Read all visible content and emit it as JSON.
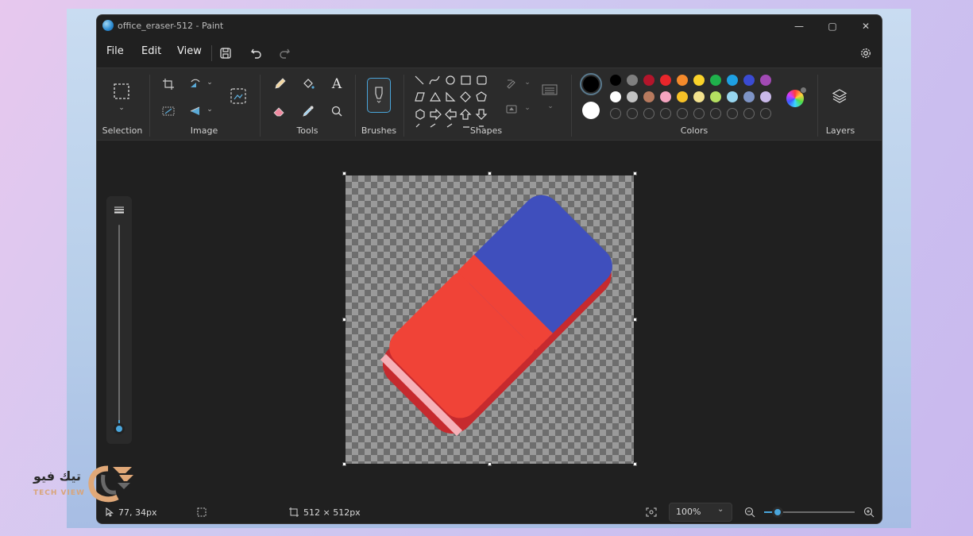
{
  "window": {
    "title": "office_eraser-512 - Paint",
    "min_glyph": "—",
    "max_glyph": "▢",
    "close_glyph": "✕"
  },
  "menu": {
    "file": "File",
    "edit": "Edit",
    "view": "View"
  },
  "ribbon": {
    "groups": {
      "selection": "Selection",
      "image": "Image",
      "tools": "Tools",
      "brushes": "Brushes",
      "shapes": "Shapes",
      "colors": "Colors",
      "layers": "Layers"
    }
  },
  "colors": {
    "primary": "#000000",
    "secondary": "#ffffff",
    "row1": [
      "#000000",
      "#7f7f7f",
      "#b3152b",
      "#e8262b",
      "#f58a2b",
      "#fbd32a",
      "#1fb14b",
      "#1ea0e3",
      "#3a4bd3",
      "#a24ab5"
    ],
    "row2": [
      "#ffffff",
      "#c3c3c3",
      "#b87a5e",
      "#f5a4c0",
      "#f7c127",
      "#f3e28e",
      "#b5e061",
      "#98d6ef",
      "#7e94c6",
      "#c9b9e9"
    ]
  },
  "status": {
    "cursor_pos": "77, 34px",
    "canvas_size": "512 × 512px",
    "zoom": "100%",
    "zoom_level": 0.15
  },
  "logo": {
    "arabic": "تيك فيو",
    "latin": "TECH VIEW"
  }
}
